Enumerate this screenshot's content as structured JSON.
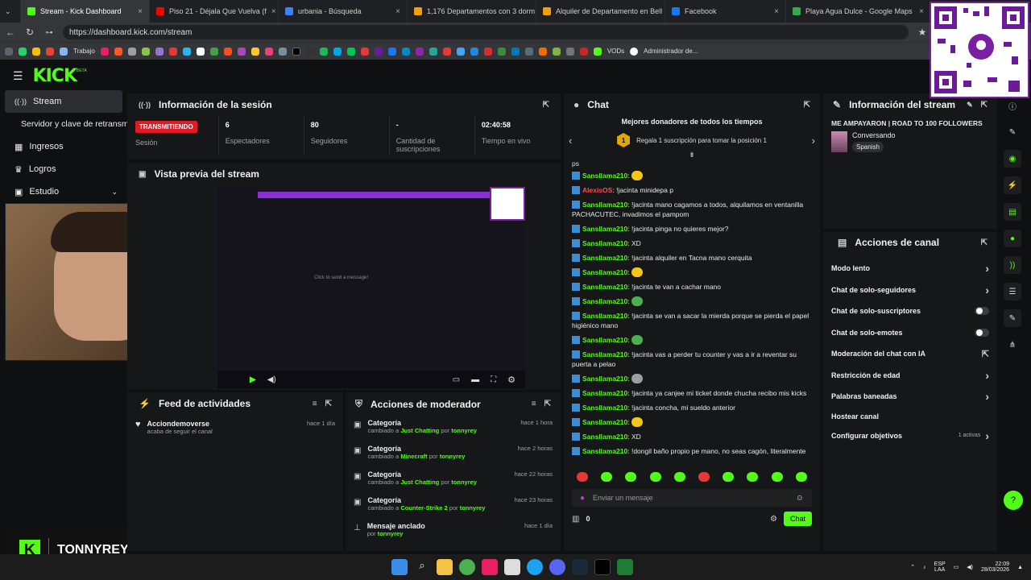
{
  "browser": {
    "tabs": [
      {
        "title": "Stream - Kick Dashboard",
        "color": "#53fc18",
        "active": true
      },
      {
        "title": "Piso 21 - Déjala Que Vuelva (f",
        "color": "#ff0000"
      },
      {
        "title": "urbania - Búsqueda",
        "color": "#3b82f6"
      },
      {
        "title": "1,176 Departamentos con 3 dorm",
        "color": "#f59e0b"
      },
      {
        "title": "Alquiler de Departamento en Bell",
        "color": "#f59e0b"
      },
      {
        "title": "Facebook",
        "color": "#1877f2"
      },
      {
        "title": "Playa Agua Dulce - Google Maps",
        "color": "#34a853"
      }
    ],
    "url": "https://dashboard.kick.com/stream",
    "bookmarks": {
      "trabajo": "Trabajo",
      "vods": "VODs",
      "admin": "Administrador de..."
    }
  },
  "app": {
    "logo": "KICK",
    "logo_badge": "BETA",
    "sidebar": [
      {
        "label": "Stream",
        "icon": "stream-icon"
      },
      {
        "label": "Servidor y clave de retransm",
        "icon": ""
      },
      {
        "label": "Ingresos",
        "icon": "revenue-icon"
      },
      {
        "label": "Logros",
        "icon": "trophy-icon"
      },
      {
        "label": "Estudio",
        "icon": "studio-icon"
      }
    ]
  },
  "session": {
    "title": "Información de la sesión",
    "status": "TRANSMITIENDO",
    "status_label": "Sesión",
    "viewers": "6",
    "viewers_label": "Espectadores",
    "followers": "80",
    "followers_label": "Seguidores",
    "subs": "-",
    "subs_label": "Cantidad de suscripciones",
    "uptime": "02:40:58",
    "uptime_label": "Tiempo en vivo"
  },
  "preview": {
    "title": "Vista previa del stream",
    "click_text": "Click to send a message!"
  },
  "webcam": {
    "brand": "TONNYREY"
  },
  "activity": {
    "title": "Feed de actividades",
    "items": [
      {
        "user": "Acciondemoverse",
        "text": "acaba de seguir el canal",
        "time": "hace 1 día"
      }
    ]
  },
  "moderator": {
    "title": "Acciones de moderador",
    "items": [
      {
        "title": "Categoría",
        "prefix": "cambiado a",
        "value": "Just Chatting",
        "by": "por",
        "user": "tonnyrey",
        "time": "hace 1 hora"
      },
      {
        "title": "Categoría",
        "prefix": "cambiado a",
        "value": "Minecraft",
        "by": "por",
        "user": "tonnyrey",
        "time": "hace 2 horas"
      },
      {
        "title": "Categoría",
        "prefix": "cambiado a",
        "value": "Just Chatting",
        "by": "por",
        "user": "tonnyrey",
        "time": "hace 22 horas"
      },
      {
        "title": "Categoría",
        "prefix": "cambiado a",
        "value": "Counter-Strike 2",
        "by": "por",
        "user": "tonnyrey",
        "time": "hace 23 horas"
      },
      {
        "title": "Mensaje anclado",
        "prefix": "por",
        "value": "tonnyrey",
        "by": "",
        "user": "",
        "time": "hace 1 día"
      }
    ]
  },
  "chat": {
    "title": "Chat",
    "donors_title": "Mejores donadores de todos los tiempos",
    "donors_rank": "1",
    "donors_text": "Regala 1 suscripción para tomar la posición 1",
    "top_text": "ps",
    "messages": [
      {
        "user": "Sansllama210",
        "text": "",
        "emote": "#f5c518"
      },
      {
        "user": "AlexisOS",
        "text": "!jacinta minidepa p",
        "red": true
      },
      {
        "user": "Sansllama210",
        "text": "!jacinta mano cagamos a todos, alquilamos en ventanilla PACHACUTEC, invadimos el pampom"
      },
      {
        "user": "Sansllama210",
        "text": "!jacinta pinga no quieres mejor?"
      },
      {
        "user": "Sansllama210",
        "text": "XD"
      },
      {
        "user": "Sansllama210",
        "text": "!jacinta alquiler en Tacna mano cerquita"
      },
      {
        "user": "Sansllama210",
        "text": "",
        "emote": "#f5c518"
      },
      {
        "user": "Sansllama210",
        "text": "!jacinta te van a cachar mano"
      },
      {
        "user": "Sansllama210",
        "text": "",
        "emote": "#4caf50"
      },
      {
        "user": "Sansllama210",
        "text": "!jacinta se van a sacar la mierda porque se pierda el papel higiénico mano"
      },
      {
        "user": "Sansllama210",
        "text": "",
        "emote": "#4caf50"
      },
      {
        "user": "Sansllama210",
        "text": "!jacinta vas a perder tu counter y vas a ir a reventar su puerta a pelao"
      },
      {
        "user": "Sansllama210",
        "text": "",
        "emote": "#9e9e9e"
      },
      {
        "user": "Sansllama210",
        "text": "!jacinta ya canjee mi ticket donde chucha recibo mis kicks"
      },
      {
        "user": "Sansllama210",
        "text": "!jacinta concha, mi sueldo anterior"
      },
      {
        "user": "Sansllama210",
        "text": "",
        "emote": "#f5c518"
      },
      {
        "user": "Sansllama210",
        "text": "XD"
      },
      {
        "user": "Sansllama210",
        "text": "!dongil baño propio pe mano, no seas cagón, literalmente"
      }
    ],
    "input_placeholder": "Enviar un mensaje",
    "kicks": "0",
    "send": "Chat"
  },
  "stream_info": {
    "title": "Información del stream",
    "stream_title": "ME AMPAYARON | ROAD TO 100 FOLLOWERS",
    "category": "Conversando",
    "language": "Spanish"
  },
  "channel_actions": {
    "title": "Acciones de canal",
    "items": [
      {
        "label": "Modo lento",
        "control": "chevron"
      },
      {
        "label": "Chat de solo-seguidores",
        "control": "chevron"
      },
      {
        "label": "Chat de solo-suscriptores",
        "control": "toggle"
      },
      {
        "label": "Chat de solo-emotes",
        "control": "toggle"
      },
      {
        "label": "Moderación del chat con IA",
        "control": "external"
      },
      {
        "label": "Restricción de edad",
        "control": "chevron"
      },
      {
        "label": "Palabras baneadas",
        "control": "chevron"
      },
      {
        "label": "Hostear canal",
        "control": "none"
      },
      {
        "label": "Configurar objetivos",
        "control": "chevron",
        "extra": "1 activas"
      }
    ]
  },
  "taskbar": {
    "lang": "ESP",
    "layout": "LAA",
    "time": "22:09",
    "date": "28/03/2026"
  },
  "colors": {
    "accent": "#53fc18",
    "panel": "#161718",
    "live": "#e01b24"
  }
}
